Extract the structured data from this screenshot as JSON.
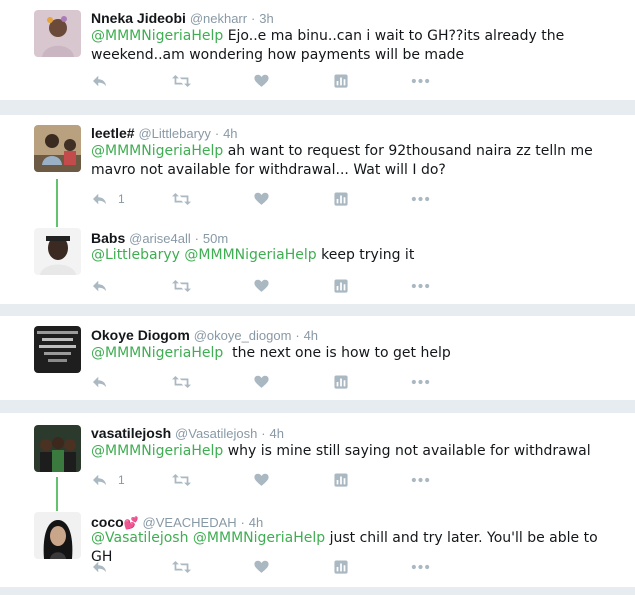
{
  "colors": {
    "mention": "#3fae52",
    "muted": "#8899a6",
    "thread_line": "#62c26e",
    "background": "#e6ecf0"
  },
  "tweets": [
    {
      "name": "Nneka Jideobi",
      "handle": "@nekharr",
      "dot": "·",
      "time": "3h",
      "mention1": "@MMMNigeriaHelp",
      "text": " Ejo..e ma binu..can i wait to GH??its already the weekend..am wondering how payments will be made",
      "avatar_icon": "profile-photo"
    },
    {
      "name": "leetle#",
      "handle": "@Littlebaryy",
      "dot": "·",
      "time": "4h",
      "mention1": "@MMMNigeriaHelp",
      "text": " ah want to request for 92thousand naira zz telln me mavro not available for withdrawal... Wat will I do?",
      "reply_count": "1",
      "avatar_icon": "profile-photo"
    },
    {
      "name": "Babs",
      "handle": "@arise4all",
      "dot": "·",
      "time": "50m",
      "mention1": "@Littlebaryy",
      "mention2": "@MMMNigeriaHelp",
      "text": " keep trying it",
      "avatar_icon": "profile-photo"
    },
    {
      "name": "Okoye Diogom",
      "handle": "@okoye_diogom",
      "dot": "·",
      "time": "4h",
      "mention1": "@MMMNigeriaHelp",
      "text": "  the next one is how to get help",
      "avatar_icon": "profile-photo"
    },
    {
      "name": "vasatilejosh",
      "handle": "@Vasatilejosh",
      "dot": "·",
      "time": "4h",
      "mention1": "@MMMNigeriaHelp",
      "text": " why is mine still saying not available for withdrawal",
      "reply_count": "1",
      "avatar_icon": "profile-photo"
    },
    {
      "name": "coco",
      "name_emoji": "💕",
      "handle": "@VEACHEDAH",
      "dot": "·",
      "time": "4h",
      "mention1": "@Vasatilejosh",
      "mention2": "@MMMNigeriaHelp",
      "text": " just chill and try later. You'll be able to GH",
      "avatar_icon": "profile-photo"
    }
  ],
  "action_icons": [
    "reply-icon",
    "retweet-icon",
    "like-icon",
    "analytics-icon",
    "more-icon"
  ]
}
